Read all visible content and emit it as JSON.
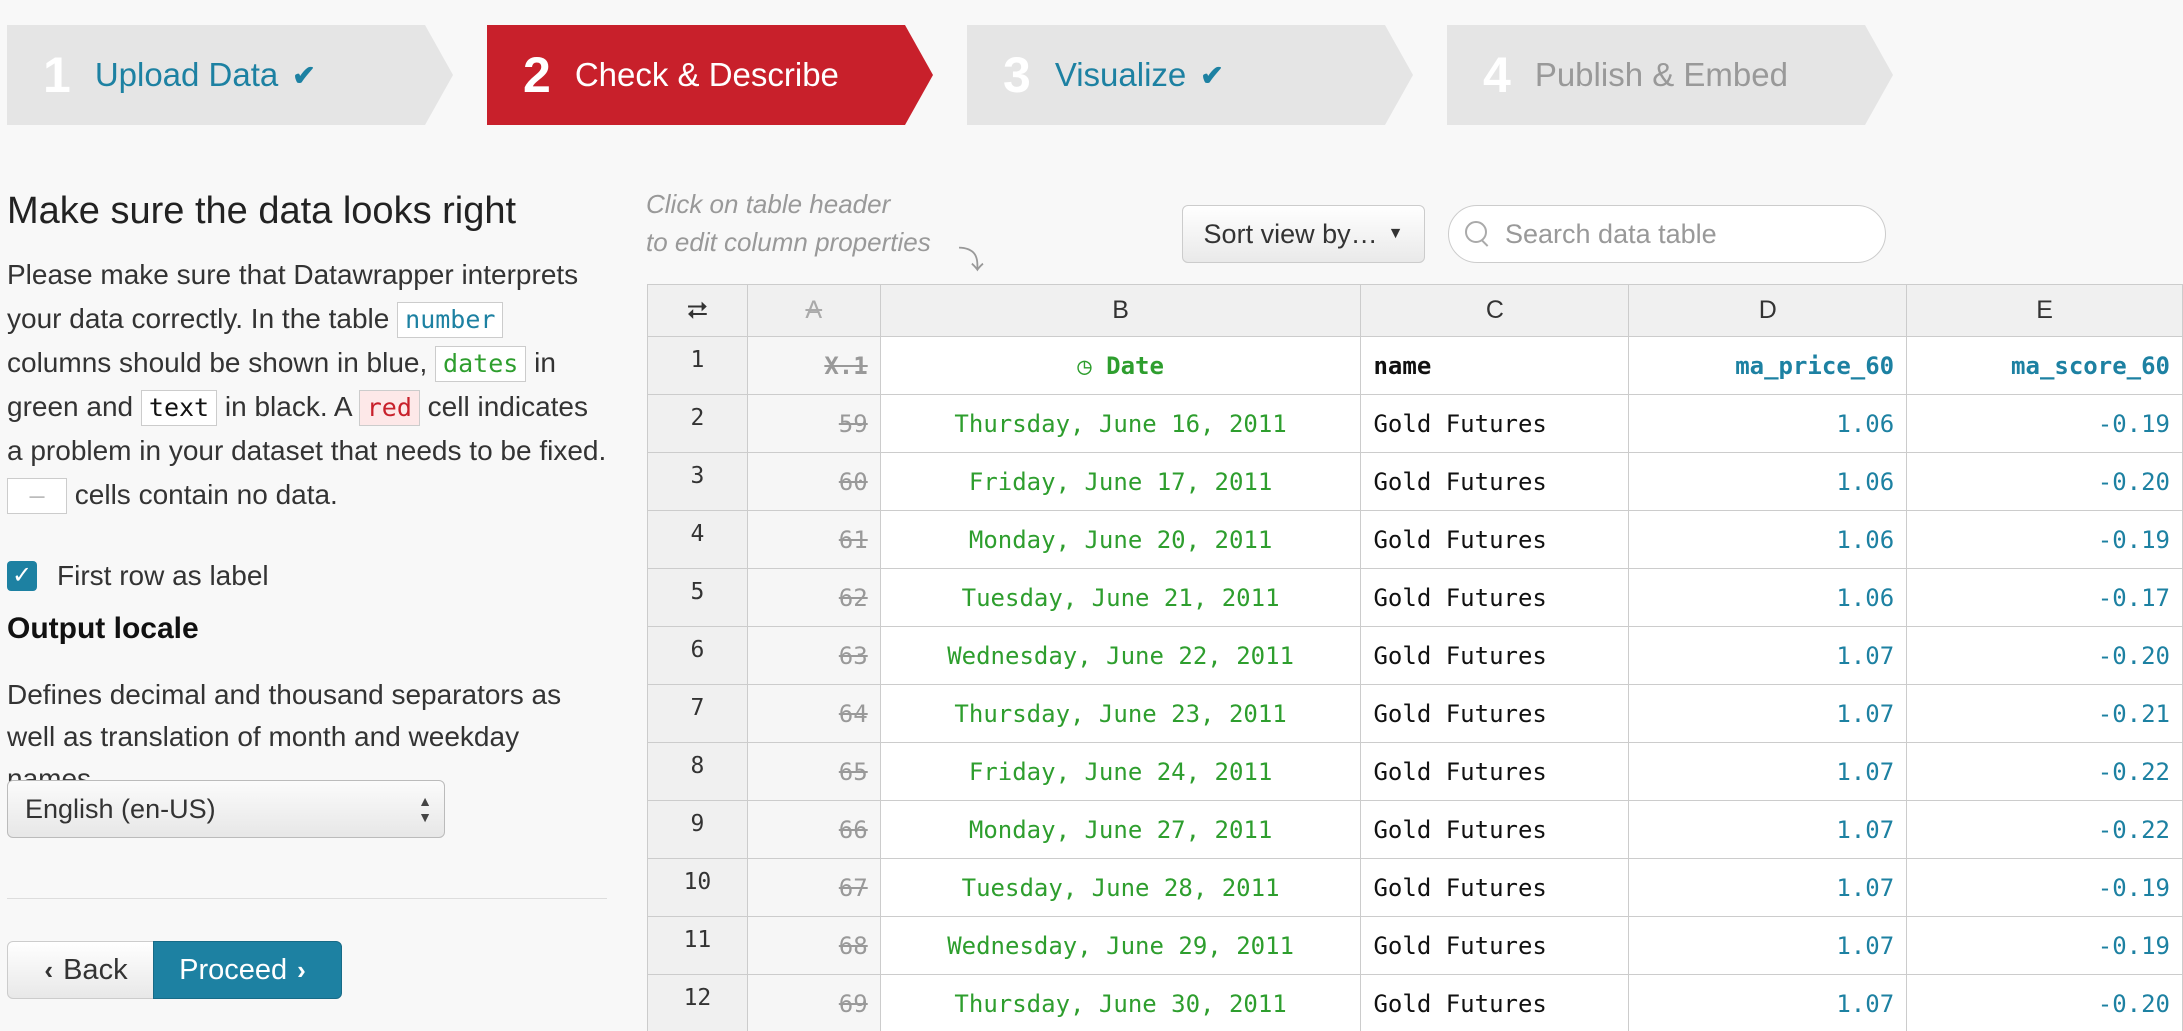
{
  "steps": [
    {
      "num": "1",
      "label": "Upload Data",
      "check": "✔"
    },
    {
      "num": "2",
      "label": "Check & Describe",
      "check": ""
    },
    {
      "num": "3",
      "label": "Visualize",
      "check": "✔"
    },
    {
      "num": "4",
      "label": "Publish & Embed",
      "check": ""
    }
  ],
  "left": {
    "title": "Make sure the data looks right",
    "desc_1": "Please make sure that Datawrapper interprets your data correctly. In the table ",
    "tag_number": "number",
    "desc_2": " columns should be shown in blue, ",
    "tag_dates": "dates",
    "desc_3": " in green and ",
    "tag_text": "text",
    "desc_4": " in black. A ",
    "tag_red": "red",
    "desc_5": " cell indicates a problem in your dataset that needs to be fixed. ",
    "tag_empty": "—",
    "desc_6": " cells contain no data.",
    "first_row_label": "First row as label",
    "locale_heading": "Output locale",
    "locale_desc": "Defines decimal and thousand separators as well as translation of month and weekday names.",
    "locale_value": "English (en-US)",
    "back_label": "Back",
    "proceed_label": "Proceed"
  },
  "toolbar": {
    "hint_line1": "Click on table header",
    "hint_line2": "to edit column properties",
    "sort_label": "Sort view by…",
    "search_placeholder": "Search data table"
  },
  "table": {
    "col_letters": [
      "A",
      "B",
      "C",
      "D",
      "E"
    ],
    "header_row": {
      "num": "1",
      "cells": [
        "X.1",
        "Date",
        "name",
        "ma_price_60",
        "ma_score_60"
      ]
    },
    "rows": [
      {
        "num": "2",
        "cells": [
          "59",
          "Thursday, June 16, 2011",
          "Gold Futures",
          "1.06",
          "-0.19"
        ]
      },
      {
        "num": "3",
        "cells": [
          "60",
          "Friday, June 17, 2011",
          "Gold Futures",
          "1.06",
          "-0.20"
        ]
      },
      {
        "num": "4",
        "cells": [
          "61",
          "Monday, June 20, 2011",
          "Gold Futures",
          "1.06",
          "-0.19"
        ]
      },
      {
        "num": "5",
        "cells": [
          "62",
          "Tuesday, June 21, 2011",
          "Gold Futures",
          "1.06",
          "-0.17"
        ]
      },
      {
        "num": "6",
        "cells": [
          "63",
          "Wednesday, June 22, 2011",
          "Gold Futures",
          "1.07",
          "-0.20"
        ]
      },
      {
        "num": "7",
        "cells": [
          "64",
          "Thursday, June 23, 2011",
          "Gold Futures",
          "1.07",
          "-0.21"
        ]
      },
      {
        "num": "8",
        "cells": [
          "65",
          "Friday, June 24, 2011",
          "Gold Futures",
          "1.07",
          "-0.22"
        ]
      },
      {
        "num": "9",
        "cells": [
          "66",
          "Monday, June 27, 2011",
          "Gold Futures",
          "1.07",
          "-0.22"
        ]
      },
      {
        "num": "10",
        "cells": [
          "67",
          "Tuesday, June 28, 2011",
          "Gold Futures",
          "1.07",
          "-0.19"
        ]
      },
      {
        "num": "11",
        "cells": [
          "68",
          "Wednesday, June 29, 2011",
          "Gold Futures",
          "1.07",
          "-0.19"
        ]
      },
      {
        "num": "12",
        "cells": [
          "69",
          "Thursday, June 30, 2011",
          "Gold Futures",
          "1.07",
          "-0.20"
        ]
      }
    ]
  },
  "colors": {
    "accent": "#1d81a2",
    "active_step": "#c8202b",
    "date_green": "#2e9e2e"
  }
}
